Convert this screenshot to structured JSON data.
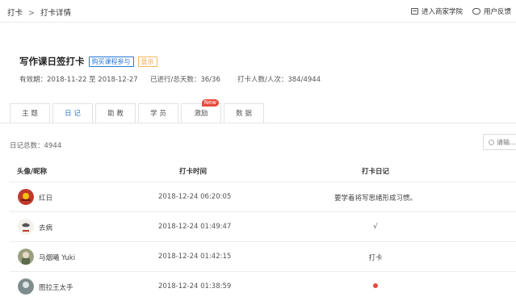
{
  "breadcrumb": {
    "root": "打卡",
    "sep": ">",
    "current": "打卡详情"
  },
  "toplinks": {
    "academy": "进入商家学院",
    "feedback": "用户反馈"
  },
  "title": {
    "text": "写作课日签打卡",
    "tag_buy": "购买课程参与",
    "tag_show": "显示"
  },
  "meta": {
    "period": "有效期：2018-11-22 至 2018-12-27",
    "days": "已进行/总天数：36/36",
    "people": "打卡人数/人次：384/4944"
  },
  "tabs": [
    {
      "label": "主 题"
    },
    {
      "label": "日 记",
      "active": true
    },
    {
      "label": "助 教"
    },
    {
      "label": "学 员"
    },
    {
      "label": "激励",
      "badge": "New"
    },
    {
      "label": "数 据"
    }
  ],
  "total": "日记总数：4944",
  "search": {
    "placeholder": "请输..."
  },
  "table": {
    "headers": {
      "user": "头像/昵称",
      "time": "打卡时间",
      "diary": "打卡日记"
    },
    "rows": [
      {
        "nick": "红日",
        "time": "2018-12-24 06:20:05",
        "diary": "要学着将写思绪形成习惯。"
      },
      {
        "nick": "去病",
        "time": "2018-12-24 01:49:47",
        "diary": "√"
      },
      {
        "nick": "马烟曦 Yuki",
        "time": "2018-12-24 01:42:15",
        "diary": "打卡"
      },
      {
        "nick": "图拉王太手",
        "time": "2018-12-24 01:38:59",
        "diary": ""
      }
    ]
  },
  "colors": {
    "accent": "#2a78d6",
    "badge": "#e74c3c",
    "tag_orange": "#f0a040"
  }
}
